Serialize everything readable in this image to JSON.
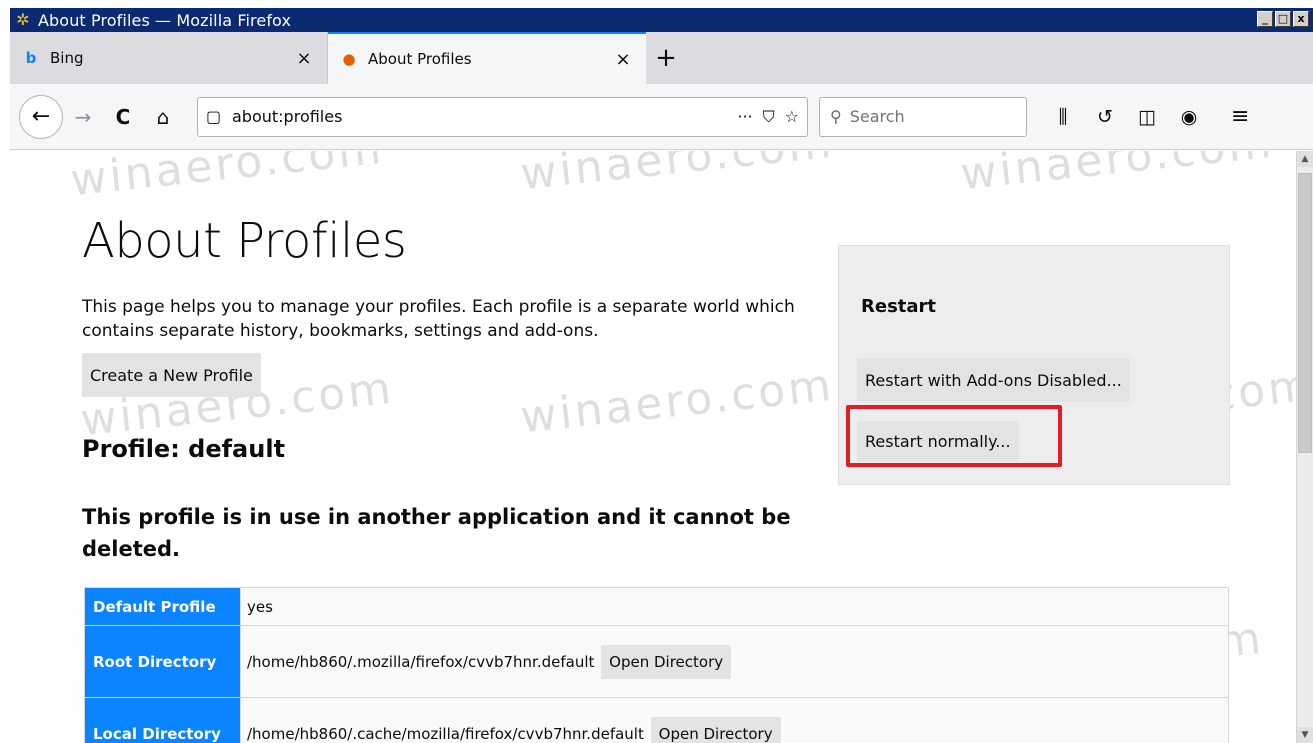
{
  "window": {
    "title": "About Profiles — Mozilla Firefox",
    "buttons": [
      "_",
      "□",
      "x"
    ]
  },
  "tabs": [
    {
      "label": "Bing",
      "icon": "bing-icon",
      "active": false
    },
    {
      "label": "About Profiles",
      "icon": "firefox-icon",
      "active": true
    }
  ],
  "tab_close_glyph": "×",
  "new_tab_glyph": "+",
  "navbar": {
    "url": "about:profiles",
    "search_placeholder": "Search",
    "page_actions_glyph": "···"
  },
  "watermark": "winaero.com",
  "page": {
    "title": "About Profiles",
    "intro": "This page helps you to manage your profiles. Each profile is a separate world which contains separate history, bookmarks, settings and add-ons.",
    "create_button": "Create a New Profile",
    "profile_heading": "Profile: default",
    "in_use_notice": "This profile is in use in another application and it cannot be deleted."
  },
  "restart": {
    "title": "Restart",
    "addons_disabled_button": "Restart with Add-ons Disabled...",
    "normally_button": "Restart normally..."
  },
  "profile_table": {
    "rows": [
      {
        "key": "Default Profile",
        "value": "yes",
        "button": ""
      },
      {
        "key": "Root Directory",
        "value": "/home/hb860/.mozilla/firefox/cvvb7hnr.default",
        "button": "Open Directory"
      },
      {
        "key": "Local Directory",
        "value": "/home/hb860/.cache/mozilla/firefox/cvvb7hnr.default",
        "button": "Open Directory"
      }
    ]
  },
  "colors": {
    "accent": "#0a84ff",
    "highlight": "#e01e24",
    "titlebar": "#0a2a78"
  }
}
